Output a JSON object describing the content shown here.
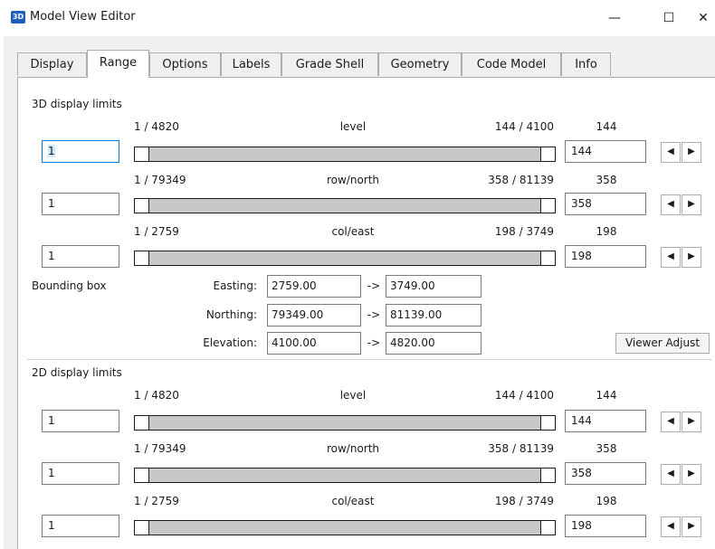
{
  "window": {
    "icon_text": "3D",
    "title": "Model View Editor",
    "minimize": "—",
    "maximize": "☐",
    "close": "✕"
  },
  "tabs": [
    {
      "label": "Display"
    },
    {
      "label": "Range"
    },
    {
      "label": "Options"
    },
    {
      "label": "Labels"
    },
    {
      "label": "Grade Shell"
    },
    {
      "label": "Geometry"
    },
    {
      "label": "Code Model"
    },
    {
      "label": "Info"
    }
  ],
  "active_tab": "Range",
  "display3d": {
    "title": "3D display limits",
    "rows": [
      {
        "range_left": "1 / 4820",
        "name": "level",
        "range_right": "144 / 4100",
        "value": "144",
        "min_input": "1",
        "max_input": "144"
      },
      {
        "range_left": "1 / 79349",
        "name": "row/north",
        "range_right": "358 / 81139",
        "value": "358",
        "min_input": "1",
        "max_input": "358"
      },
      {
        "range_left": "1 / 2759",
        "name": "col/east",
        "range_right": "198 / 3749",
        "value": "198",
        "min_input": "1",
        "max_input": "198"
      }
    ]
  },
  "bounding_box": {
    "title": "Bounding box",
    "arrow": "->",
    "rows": [
      {
        "label": "Easting:",
        "from": "2759.00",
        "to": "3749.00"
      },
      {
        "label": "Northing:",
        "from": "79349.00",
        "to": "81139.00"
      },
      {
        "label": "Elevation:",
        "from": "4100.00",
        "to": "4820.00"
      }
    ],
    "viewer_adjust": "Viewer Adjust"
  },
  "display2d": {
    "title": "2D display limits",
    "rows": [
      {
        "range_left": "1 / 4820",
        "name": "level",
        "range_right": "144 / 4100",
        "value": "144",
        "min_input": "1",
        "max_input": "144"
      },
      {
        "range_left": "1 / 79349",
        "name": "row/north",
        "range_right": "358 / 81139",
        "value": "358",
        "min_input": "1",
        "max_input": "358"
      },
      {
        "range_left": "1 / 2759",
        "name": "col/east",
        "range_right": "198 / 3749",
        "value": "198",
        "min_input": "1",
        "max_input": "198"
      }
    ]
  },
  "icons": {
    "spin_left": "left-triangle-icon",
    "spin_right": "right-triangle-icon"
  }
}
